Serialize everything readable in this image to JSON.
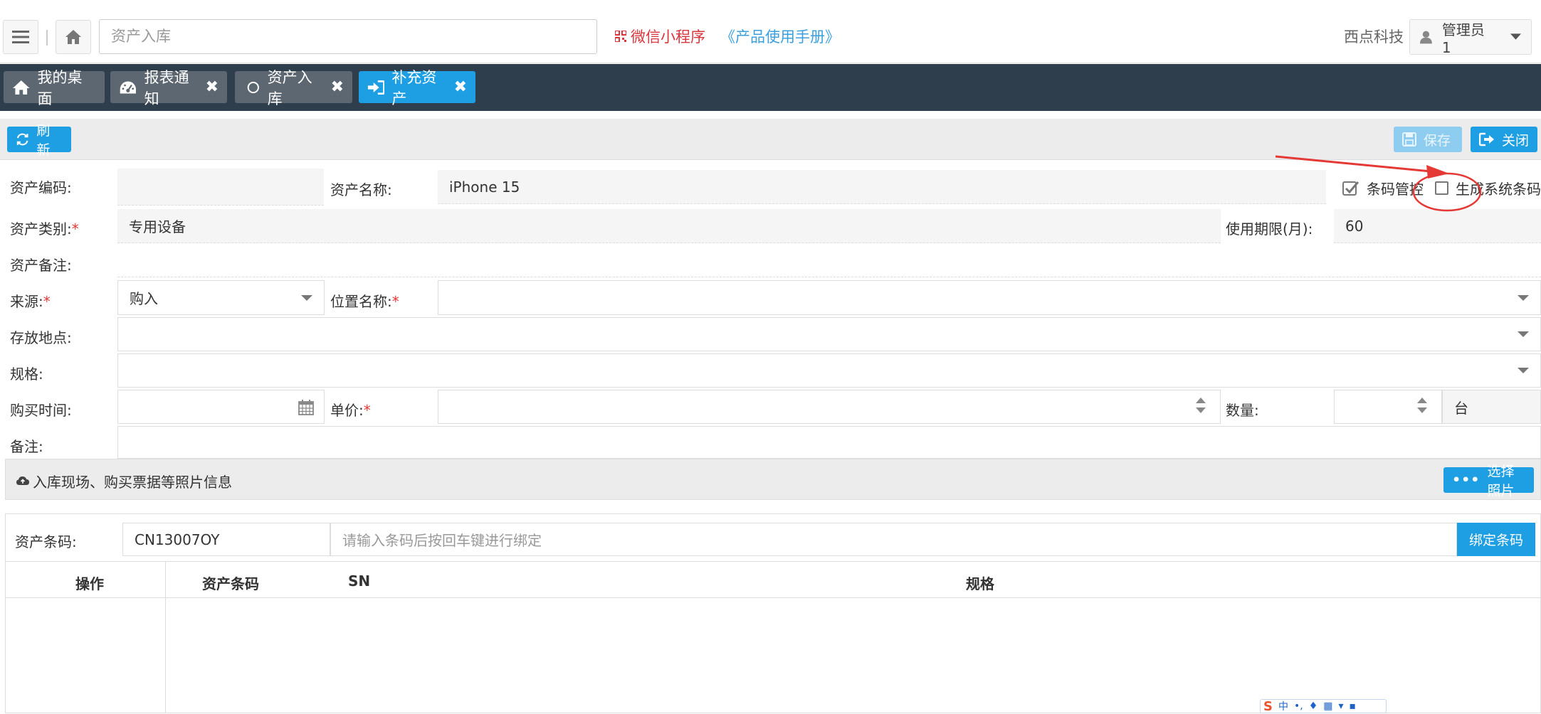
{
  "topbar": {
    "search_placeholder": "资产入库",
    "miniapp_label": "微信小程序",
    "manual_label": "《产品使用手册》",
    "company": "西点科技",
    "user": "管理员1"
  },
  "tabs": [
    {
      "label": "我的桌面",
      "icon": "home-icon"
    },
    {
      "label": "报表通知",
      "icon": "dashboard-icon"
    },
    {
      "label": "资产入库",
      "icon": "circle-icon"
    },
    {
      "label": "补充资产",
      "icon": "sign-in-icon"
    }
  ],
  "toolbar": {
    "refresh": "刷新",
    "save": "保存",
    "close": "关闭"
  },
  "form": {
    "asset_code_label": "资产编码:",
    "asset_code_value": "",
    "asset_name_label": "资产名称:",
    "asset_name_value": "iPhone 15",
    "barcode_manage_label": "条码管控",
    "gen_barcode_label": "生成系统条码",
    "category_label": "资产类别:",
    "category_value": "专用设备",
    "life_label": "使用期限(月):",
    "life_value": "60",
    "remark_asset_label": "资产备注:",
    "source_label": "来源:",
    "source_value": "购入",
    "location_label": "位置名称:",
    "storage_label": "存放地点:",
    "spec_label": "规格:",
    "purchase_time_label": "购买时间:",
    "unit_price_label": "单价:",
    "qty_label": "数量:",
    "qty_unit": "台",
    "note_label": "备注:",
    "required_mark": "*"
  },
  "photo": {
    "label": "入库现场、购买票据等照片信息",
    "button": "选择照片"
  },
  "barcode": {
    "label": "资产条码:",
    "value": "CN13007OY",
    "input_placeholder": "请输入条码后按回车键进行绑定",
    "bind_button": "绑定条码"
  },
  "table": {
    "headers": [
      "操作",
      "资产条码",
      "SN",
      "规格"
    ]
  },
  "ime": {
    "label": "中"
  },
  "colors": {
    "accent": "#1e9fe4",
    "tabbar": "#2f3e4c",
    "annotation": "#e53935"
  }
}
